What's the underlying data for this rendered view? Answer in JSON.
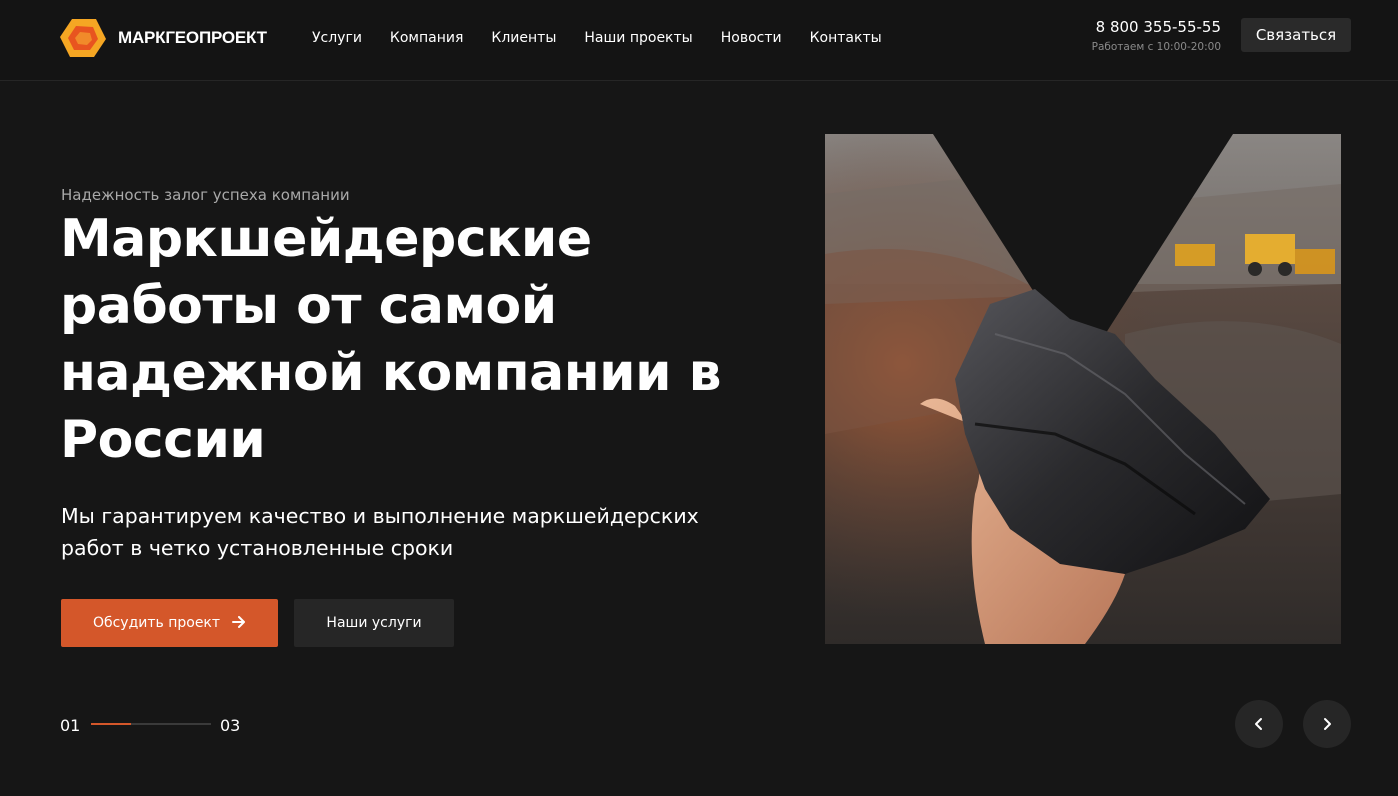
{
  "brand": {
    "name": "МАРКГЕОПРОЕКТ",
    "logo_icon": "pentagon-gem-logo",
    "colors": {
      "accent": "#d4572a",
      "logo_outer": "#f5a623",
      "logo_inner": "#e8541f"
    }
  },
  "nav": {
    "items": [
      {
        "label": "Услуги"
      },
      {
        "label": "Компания"
      },
      {
        "label": "Клиенты"
      },
      {
        "label": "Наши проекты"
      },
      {
        "label": "Новости"
      },
      {
        "label": "Контакты"
      }
    ]
  },
  "contact": {
    "phone": "8 800 355-55-55",
    "hours": "Работаем с 10:00-20:00",
    "button_label": "Связаться"
  },
  "hero": {
    "eyebrow": "Надежность залог успеха компании",
    "title": "Маркшейдерские работы от самой надежной компании в России",
    "subtitle": "Мы гарантируем качество и выполнение маркшейдерских работ в четко установленные сроки",
    "primary_button": "Обсудить проект",
    "primary_button_icon": "arrow-right-icon",
    "secondary_button": "Наши услуги",
    "image_description_icon": "hand-holding-coal-image"
  },
  "slider": {
    "current": "01",
    "total": "03",
    "progress": 0.33,
    "prev_icon": "chevron-left-icon",
    "next_icon": "chevron-right-icon"
  }
}
